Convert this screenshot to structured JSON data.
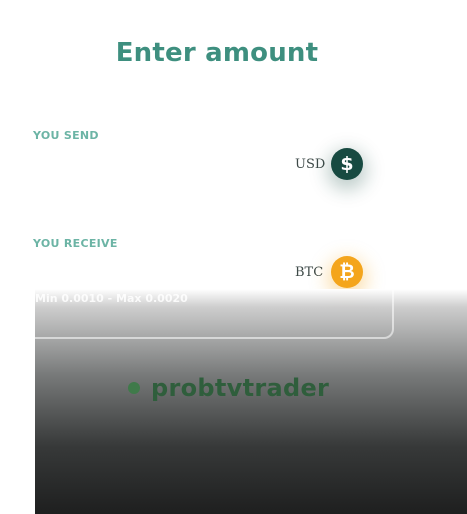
{
  "header": {
    "title": "Enter amount"
  },
  "send": {
    "label": "YOU SEND",
    "amount": "",
    "currency_code": "USD",
    "icon": "dollar-sign-icon",
    "icon_glyph": "$",
    "icon_color": "#174a41"
  },
  "receive": {
    "label": "YOU RECEIVE",
    "amount": "",
    "currency_code": "BTC",
    "icon": "bitcoin-icon",
    "icon_glyph": "₿",
    "icon_color": "#f4a51c",
    "limits": "Min 0.0010 - Max 0.0020"
  },
  "watermark": {
    "brand": "probtvtrader",
    "dot_color": "#3f7a4a"
  },
  "colors": {
    "accent": "#3e8f7f",
    "label": "#6cb4a5"
  }
}
